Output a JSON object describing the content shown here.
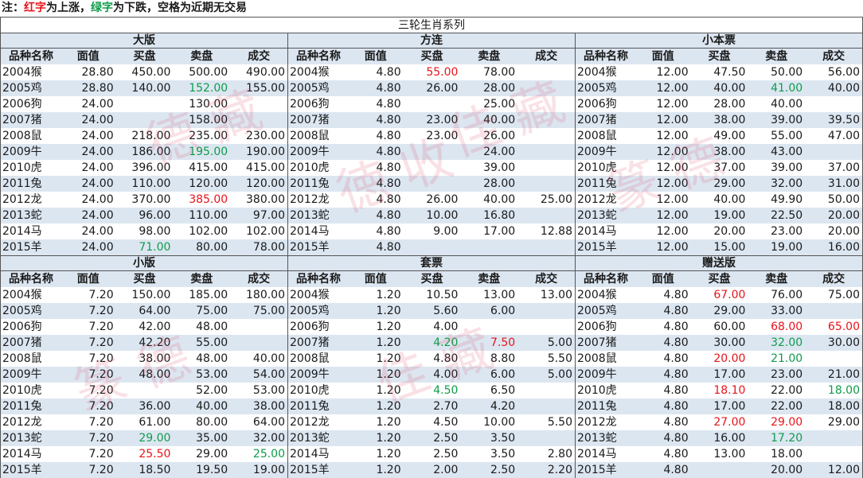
{
  "note": {
    "prefix": "注：",
    "red_text": "红字",
    "mid": "为上涨，",
    "green_text": "绿字",
    "suffix": "为下跌，空格为近期无交易"
  },
  "main_title": "三轮生肖系列",
  "headers": [
    "品种名称",
    "面值",
    "买盘",
    "卖盘",
    "成交"
  ],
  "colors": {
    "up": "#e8141b",
    "down": "#0f9c4a",
    "band": "#dce6f1"
  },
  "tables": [
    {
      "title": "大版",
      "rows": [
        {
          "name": "2004猴",
          "face": "28.80",
          "bid": "450.00",
          "ask": "500.00",
          "deal": "490.00"
        },
        {
          "name": "2005鸡",
          "face": "28.80",
          "bid": "140.00",
          "ask": "152.00",
          "deal": "155.00",
          "ask_c": "g"
        },
        {
          "name": "2006狗",
          "face": "24.00",
          "bid": "",
          "ask": "130.00",
          "deal": ""
        },
        {
          "name": "2007猪",
          "face": "24.00",
          "bid": "",
          "ask": "158.00",
          "deal": ""
        },
        {
          "name": "2008鼠",
          "face": "24.00",
          "bid": "218.00",
          "ask": "235.00",
          "deal": "230.00"
        },
        {
          "name": "2009牛",
          "face": "24.00",
          "bid": "186.00",
          "ask": "195.00",
          "deal": "190.00",
          "ask_c": "g"
        },
        {
          "name": "2010虎",
          "face": "24.00",
          "bid": "396.00",
          "ask": "415.00",
          "deal": "415.00"
        },
        {
          "name": "2011兔",
          "face": "24.00",
          "bid": "110.00",
          "ask": "120.00",
          "deal": "120.00"
        },
        {
          "name": "2012龙",
          "face": "24.00",
          "bid": "370.00",
          "ask": "385.00",
          "deal": "380.00",
          "ask_c": "r"
        },
        {
          "name": "2013蛇",
          "face": "24.00",
          "bid": "96.00",
          "ask": "110.00",
          "deal": "97.00"
        },
        {
          "name": "2014马",
          "face": "24.00",
          "bid": "98.00",
          "ask": "102.00",
          "deal": "102.00"
        },
        {
          "name": "2015羊",
          "face": "24.00",
          "bid": "71.00",
          "ask": "80.00",
          "deal": "78.00",
          "bid_c": "g"
        }
      ]
    },
    {
      "title": "方连",
      "rows": [
        {
          "name": "2004猴",
          "face": "4.80",
          "bid": "55.00",
          "ask": "78.00",
          "deal": "",
          "bid_c": "r"
        },
        {
          "name": "2005鸡",
          "face": "4.80",
          "bid": "26.00",
          "ask": "28.00",
          "deal": ""
        },
        {
          "name": "2006狗",
          "face": "4.80",
          "bid": "",
          "ask": "25.00",
          "deal": ""
        },
        {
          "name": "2007猪",
          "face": "4.80",
          "bid": "23.00",
          "ask": "40.00",
          "deal": ""
        },
        {
          "name": "2008鼠",
          "face": "4.80",
          "bid": "23.00",
          "ask": "26.00",
          "deal": ""
        },
        {
          "name": "2009牛",
          "face": "4.80",
          "bid": "",
          "ask": "24.00",
          "deal": ""
        },
        {
          "name": "2010虎",
          "face": "4.80",
          "bid": "",
          "ask": "39.00",
          "deal": ""
        },
        {
          "name": "2011兔",
          "face": "4.80",
          "bid": "",
          "ask": "28.00",
          "deal": ""
        },
        {
          "name": "2012龙",
          "face": "4.80",
          "bid": "26.00",
          "ask": "40.00",
          "deal": "25.00"
        },
        {
          "name": "2013蛇",
          "face": "4.80",
          "bid": "10.00",
          "ask": "16.80",
          "deal": ""
        },
        {
          "name": "2014马",
          "face": "4.80",
          "bid": "9.00",
          "ask": "17.00",
          "deal": "12.88"
        },
        {
          "name": "2015羊",
          "face": "4.80",
          "bid": "",
          "ask": "",
          "deal": ""
        }
      ]
    },
    {
      "title": "小本票",
      "rows": [
        {
          "name": "2004猴",
          "face": "12.00",
          "bid": "47.50",
          "ask": "50.00",
          "deal": "56.00"
        },
        {
          "name": "2005鸡",
          "face": "12.00",
          "bid": "40.00",
          "ask": "41.00",
          "deal": "40.00",
          "ask_c": "g"
        },
        {
          "name": "2006狗",
          "face": "12.00",
          "bid": "28.00",
          "ask": "40.00",
          "deal": ""
        },
        {
          "name": "2007猪",
          "face": "12.00",
          "bid": "38.00",
          "ask": "39.00",
          "deal": "39.50"
        },
        {
          "name": "2008鼠",
          "face": "12.00",
          "bid": "49.00",
          "ask": "55.00",
          "deal": "47.00"
        },
        {
          "name": "2009牛",
          "face": "12.00",
          "bid": "38.00",
          "ask": "43.00",
          "deal": ""
        },
        {
          "name": "2010虎",
          "face": "12.00",
          "bid": "37.00",
          "ask": "39.00",
          "deal": "37.00"
        },
        {
          "name": "2011兔",
          "face": "12.00",
          "bid": "29.00",
          "ask": "32.00",
          "deal": "31.00"
        },
        {
          "name": "2012龙",
          "face": "12.00",
          "bid": "40.00",
          "ask": "49.90",
          "deal": "50.00"
        },
        {
          "name": "2013蛇",
          "face": "12.00",
          "bid": "19.00",
          "ask": "22.50",
          "deal": "20.00"
        },
        {
          "name": "2014马",
          "face": "12.00",
          "bid": "20.00",
          "ask": "23.00",
          "deal": "20.00"
        },
        {
          "name": "2015羊",
          "face": "12.00",
          "bid": "15.00",
          "ask": "19.00",
          "deal": "16.00"
        }
      ]
    },
    {
      "title": "小版",
      "rows": [
        {
          "name": "2004猴",
          "face": "7.20",
          "bid": "150.00",
          "ask": "185.00",
          "deal": "180.00"
        },
        {
          "name": "2005鸡",
          "face": "7.20",
          "bid": "64.00",
          "ask": "75.00",
          "deal": "75.00"
        },
        {
          "name": "2006狗",
          "face": "7.20",
          "bid": "42.00",
          "ask": "48.00",
          "deal": ""
        },
        {
          "name": "2007猪",
          "face": "7.20",
          "bid": "42.20",
          "ask": "55.00",
          "deal": ""
        },
        {
          "name": "2008鼠",
          "face": "7.20",
          "bid": "38.00",
          "ask": "48.00",
          "deal": "40.00"
        },
        {
          "name": "2009牛",
          "face": "7.20",
          "bid": "48.00",
          "ask": "53.00",
          "deal": "54.00"
        },
        {
          "name": "2010虎",
          "face": "7.20",
          "bid": "",
          "ask": "52.00",
          "deal": "53.00"
        },
        {
          "name": "2011兔",
          "face": "7.20",
          "bid": "36.00",
          "ask": "40.00",
          "deal": "38.00"
        },
        {
          "name": "2012龙",
          "face": "7.20",
          "bid": "61.00",
          "ask": "80.00",
          "deal": "64.00"
        },
        {
          "name": "2013蛇",
          "face": "7.20",
          "bid": "29.00",
          "ask": "35.00",
          "deal": "32.00",
          "bid_c": "g"
        },
        {
          "name": "2014马",
          "face": "7.20",
          "bid": "25.50",
          "ask": "29.00",
          "deal": "25.00",
          "bid_c": "r",
          "deal_c": "g"
        },
        {
          "name": "2015羊",
          "face": "7.20",
          "bid": "18.50",
          "ask": "19.50",
          "deal": "19.00"
        }
      ]
    },
    {
      "title": "套票",
      "rows": [
        {
          "name": "2004猴",
          "face": "1.20",
          "bid": "10.50",
          "ask": "13.00",
          "deal": "13.00"
        },
        {
          "name": "2005鸡",
          "face": "1.20",
          "bid": "5.60",
          "ask": "6.00",
          "deal": ""
        },
        {
          "name": "2006狗",
          "face": "1.20",
          "bid": "4.00",
          "ask": "",
          "deal": ""
        },
        {
          "name": "2007猪",
          "face": "1.20",
          "bid": "4.20",
          "ask": "7.50",
          "deal": "5.00",
          "bid_c": "g",
          "ask_c": "r"
        },
        {
          "name": "2008鼠",
          "face": "1.20",
          "bid": "4.80",
          "ask": "8.80",
          "deal": "5.50"
        },
        {
          "name": "2009牛",
          "face": "1.20",
          "bid": "4.00",
          "ask": "6.00",
          "deal": "5.00"
        },
        {
          "name": "2010虎",
          "face": "1.20",
          "bid": "4.50",
          "ask": "6.50",
          "deal": "",
          "bid_c": "g"
        },
        {
          "name": "2011兔",
          "face": "1.20",
          "bid": "2.70",
          "ask": "4.20",
          "deal": ""
        },
        {
          "name": "2012龙",
          "face": "1.20",
          "bid": "4.50",
          "ask": "10.00",
          "deal": "5.50"
        },
        {
          "name": "2013蛇",
          "face": "1.20",
          "bid": "2.50",
          "ask": "3.50",
          "deal": ""
        },
        {
          "name": "2014马",
          "face": "1.20",
          "bid": "2.50",
          "ask": "3.50",
          "deal": "2.80"
        },
        {
          "name": "2015羊",
          "face": "1.20",
          "bid": "2.00",
          "ask": "2.50",
          "deal": "2.20"
        }
      ]
    },
    {
      "title": "赠送版",
      "rows": [
        {
          "name": "2004猴",
          "face": "4.80",
          "bid": "67.00",
          "ask": "76.00",
          "deal": "75.00",
          "bid_c": "r"
        },
        {
          "name": "2005鸡",
          "face": "4.80",
          "bid": "29.00",
          "ask": "33.00",
          "deal": ""
        },
        {
          "name": "2006狗",
          "face": "4.80",
          "bid": "60.00",
          "ask": "68.00",
          "deal": "65.00",
          "ask_c": "r",
          "deal_c": "r"
        },
        {
          "name": "2007猪",
          "face": "4.80",
          "bid": "30.00",
          "ask": "32.00",
          "deal": "30.00",
          "ask_c": "g"
        },
        {
          "name": "2008鼠",
          "face": "4.80",
          "bid": "20.00",
          "ask": "21.00",
          "deal": "",
          "bid_c": "r",
          "ask_c": "g"
        },
        {
          "name": "2009牛",
          "face": "4.80",
          "bid": "17.00",
          "ask": "23.00",
          "deal": "21.00"
        },
        {
          "name": "2010虎",
          "face": "4.80",
          "bid": "18.10",
          "ask": "22.00",
          "deal": "18.00",
          "bid_c": "r",
          "deal_c": "g"
        },
        {
          "name": "2011兔",
          "face": "4.80",
          "bid": "17.00",
          "ask": "22.00",
          "deal": "18.00"
        },
        {
          "name": "2012龙",
          "face": "4.80",
          "bid": "27.00",
          "ask": "29.00",
          "deal": "29.00",
          "bid_c": "r",
          "ask_c": "r"
        },
        {
          "name": "2013蛇",
          "face": "4.80",
          "bid": "16.00",
          "ask": "17.20",
          "deal": "",
          "ask_c": "g"
        },
        {
          "name": "2014马",
          "face": "4.80",
          "bid": "13.00",
          "ask": "18.00",
          "deal": ""
        },
        {
          "name": "2015羊",
          "face": "4.80",
          "bid": "",
          "ask": "20.00",
          "deal": "12.00"
        }
      ]
    }
  ]
}
